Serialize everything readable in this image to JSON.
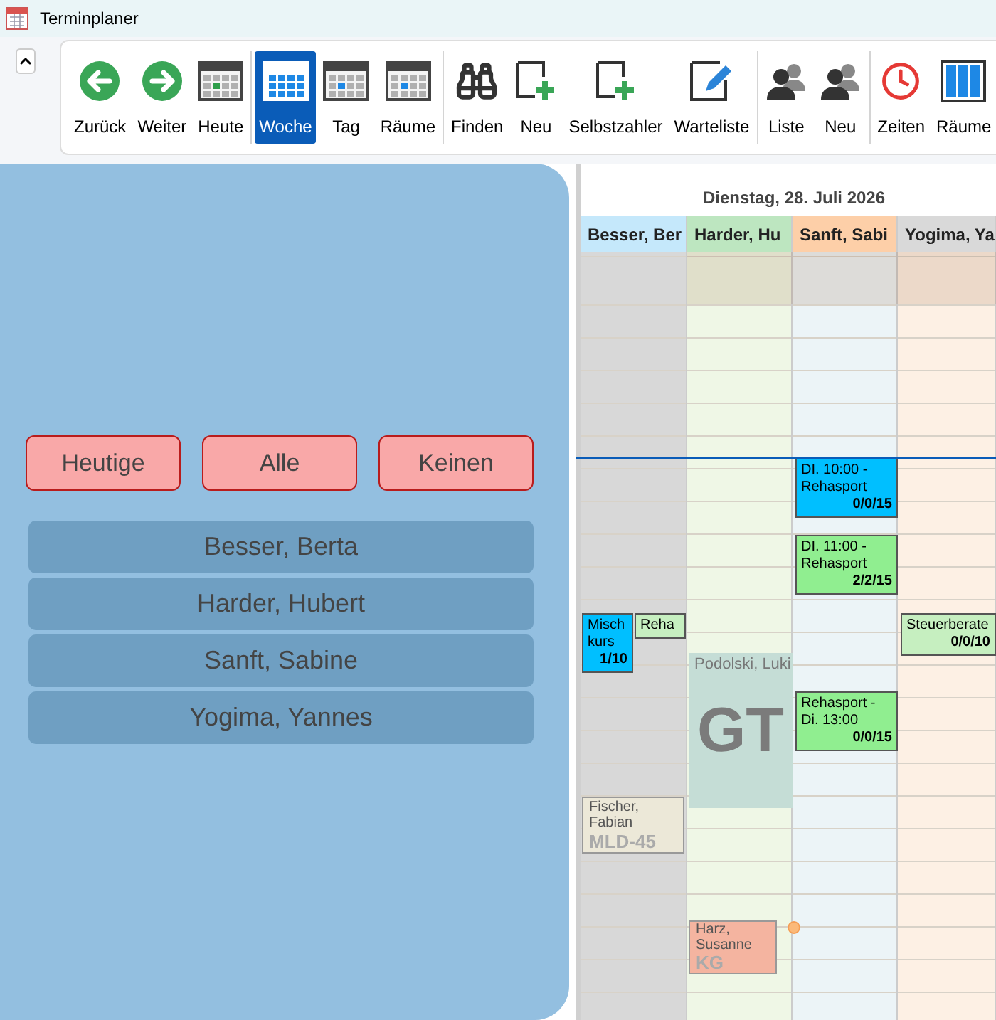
{
  "window": {
    "title": "Terminplaner"
  },
  "toolbar": {
    "groups": [
      {
        "items": [
          {
            "label": "Zurück",
            "kind": "back"
          },
          {
            "label": "Weiter",
            "kind": "forward"
          },
          {
            "label": "Heute",
            "kind": "today"
          }
        ]
      },
      {
        "items": [
          {
            "label": "Woche",
            "kind": "week",
            "selected": true
          },
          {
            "label": "Tag",
            "kind": "day",
            "selected": false
          },
          {
            "label": "Räume",
            "kind": "day",
            "selected": false
          }
        ]
      },
      {
        "items": [
          {
            "label": "Finden",
            "kind": "find"
          },
          {
            "label": "Neu",
            "kind": "new"
          },
          {
            "label": "Selbstzahler",
            "kind": "new"
          },
          {
            "label": "Warteliste",
            "kind": "edit"
          }
        ]
      },
      {
        "items": [
          {
            "label": "Liste",
            "kind": "people"
          },
          {
            "label": "Neu",
            "kind": "people"
          }
        ]
      },
      {
        "items": [
          {
            "label": "Zeiten",
            "kind": "clock"
          },
          {
            "label": "Räume",
            "kind": "columns"
          }
        ]
      }
    ]
  },
  "tuesday": {
    "title": "Dienstag, 28. Juli 2026",
    "columns": [
      {
        "name": "Besser, Ber",
        "color": "#c5e8fb",
        "events": [
          {
            "kind": "course",
            "title": "Mischkurs",
            "count": "1/10",
            "color": "#00bfff"
          },
          {
            "kind": "course",
            "title": "Reha",
            "color": "#c6efc0"
          },
          {
            "kind": "patient",
            "title": "Fischer, Fabian",
            "badge": "MLD-45",
            "color": "#ece8d8"
          }
        ]
      },
      {
        "name": "Harder, Hu",
        "color": "#bde6c0",
        "events": [
          {
            "kind": "block",
            "title": "Podolski, Luki",
            "badge": "GT",
            "color": "#c5ddd6"
          },
          {
            "kind": "patient",
            "title": "Harz, Susanne",
            "badge": "KG",
            "color": "#f4b4a0"
          }
        ]
      },
      {
        "name": "Sanft, Sabi",
        "color": "#fdcfa8",
        "events": [
          {
            "kind": "course",
            "title": "DI. 10:00 - Rehasport",
            "count": "0/0/15",
            "color": "#00bfff"
          },
          {
            "kind": "course",
            "title": "DI. 11:00 - Rehasport",
            "count": "2/2/15",
            "color": "#90ee90"
          },
          {
            "kind": "course",
            "title": "Rehasport - Di. 13:00",
            "count": "0/0/15",
            "color": "#90ee90"
          }
        ]
      },
      {
        "name": "Yogima, Ya",
        "color": "#d9d9d9",
        "events": [
          {
            "kind": "course",
            "title": "Steuerberate",
            "count": "0/0/10",
            "color": "#c6efc0"
          }
        ]
      }
    ]
  },
  "filter": {
    "buttons": [
      "Heutige",
      "Alle",
      "Keinen"
    ],
    "people": [
      "Besser, Berta",
      "Harder, Hubert",
      "Sanft, Sabine",
      "Yogima, Yannes"
    ]
  }
}
